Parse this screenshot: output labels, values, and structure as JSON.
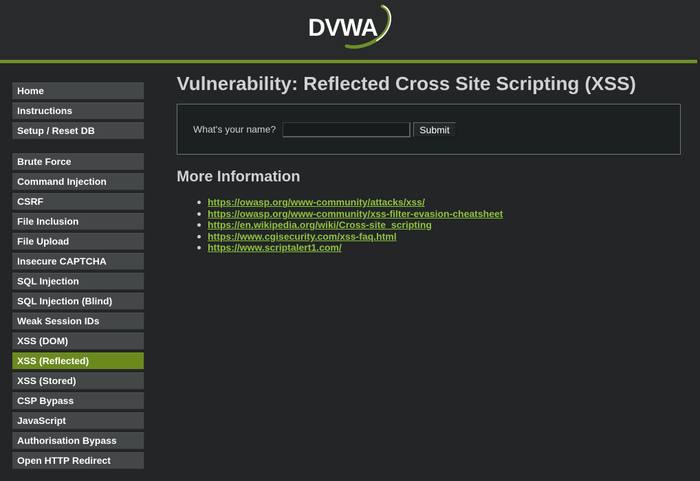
{
  "header": {
    "logo_text": "DVWA"
  },
  "sidebar": {
    "groups": [
      {
        "items": [
          {
            "label": "Home"
          },
          {
            "label": "Instructions"
          },
          {
            "label": "Setup / Reset DB"
          }
        ]
      },
      {
        "items": [
          {
            "label": "Brute Force"
          },
          {
            "label": "Command Injection"
          },
          {
            "label": "CSRF"
          },
          {
            "label": "File Inclusion"
          },
          {
            "label": "File Upload"
          },
          {
            "label": "Insecure CAPTCHA"
          },
          {
            "label": "SQL Injection"
          },
          {
            "label": "SQL Injection (Blind)"
          },
          {
            "label": "Weak Session IDs"
          },
          {
            "label": "XSS (DOM)"
          },
          {
            "label": "XSS (Reflected)",
            "selected": true
          },
          {
            "label": "XSS (Stored)"
          },
          {
            "label": "CSP Bypass"
          },
          {
            "label": "JavaScript"
          },
          {
            "label": "Authorisation Bypass"
          },
          {
            "label": "Open HTTP Redirect"
          }
        ]
      }
    ]
  },
  "main": {
    "title": "Vulnerability: Reflected Cross Site Scripting (XSS)",
    "form": {
      "label": "What's your name?",
      "input_value": "",
      "submit_label": "Submit"
    },
    "more_info": {
      "heading": "More Information",
      "links": [
        "https://owasp.org/www-community/attacks/xss/",
        "https://owasp.org/www-community/xss-filter-evasion-cheatsheet",
        "https://en.wikipedia.org/wiki/Cross-site_scripting",
        "https://www.cgisecurity.com/xss-faq.html",
        "https://www.scriptalert1.com/"
      ]
    }
  },
  "colors": {
    "accent_green": "#6b8a1e",
    "link_green": "#8fc43e",
    "background": "#232526"
  }
}
